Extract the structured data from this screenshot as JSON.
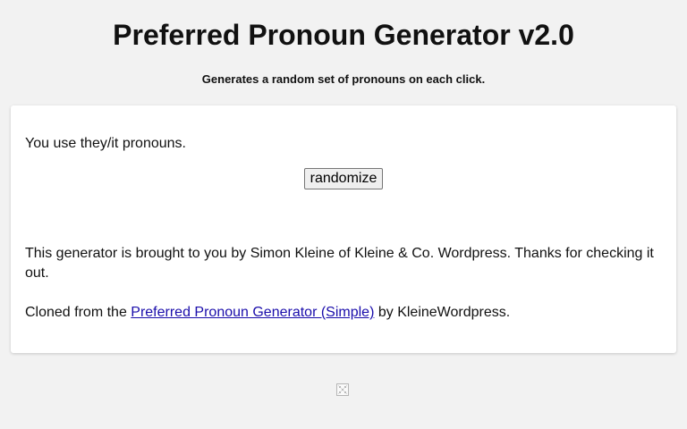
{
  "header": {
    "title": "Preferred Pronoun Generator v2.0",
    "subtitle": "Generates a random set of pronouns on each click."
  },
  "card": {
    "result_text": "You use they/it pronouns.",
    "randomize_label": "randomize",
    "credit_text": "This generator is brought to you by Simon Kleine of Kleine & Co. Wordpress. Thanks for checking it out.",
    "cloned_prefix": "Cloned from the ",
    "cloned_link": "Preferred Pronoun Generator (Simple)",
    "cloned_suffix": " by KleineWordpress."
  },
  "footer": {
    "icon": "dice-icon"
  },
  "colors": {
    "background": "#f2f2f2",
    "card": "#ffffff",
    "link": "#1a0dab"
  }
}
